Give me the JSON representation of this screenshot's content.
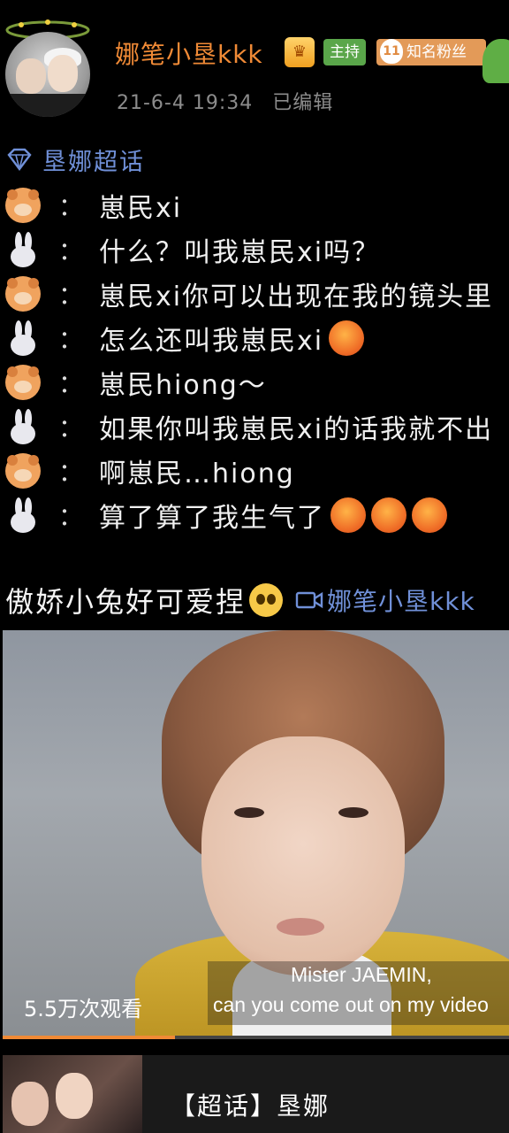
{
  "header": {
    "username": "娜笔小垦kkk",
    "timestamp": "21-6-4 19:34",
    "edited": "已编辑",
    "host_badge": "主持",
    "fan_level": "11",
    "fan_badge": "知名粉丝",
    "colors": {
      "username": "#f08a36",
      "host_badge": "#5aa64a",
      "fan_badge": "#e39a58"
    }
  },
  "topic": {
    "label": "垦娜超话",
    "color": "#7090d8",
    "icon": "diamond-icon"
  },
  "dialog": [
    {
      "speaker": "hamster",
      "text": "崽民xi",
      "angry_count": 0
    },
    {
      "speaker": "rabbit",
      "text": "什么？叫我崽民xi吗？",
      "angry_count": 0
    },
    {
      "speaker": "hamster",
      "text": "崽民xi你可以出现在我的镜头里",
      "angry_count": 0
    },
    {
      "speaker": "rabbit",
      "text": "怎么还叫我崽民xi",
      "angry_count": 1
    },
    {
      "speaker": "hamster",
      "text": "崽民hiong～",
      "angry_count": 0
    },
    {
      "speaker": "rabbit",
      "text": "如果你叫我崽民xi的话我就不出",
      "angry_count": 0
    },
    {
      "speaker": "hamster",
      "text": "啊崽民…hiong",
      "angry_count": 0
    },
    {
      "speaker": "rabbit",
      "text": "算了算了我生气了",
      "angry_count": 3
    }
  ],
  "colon": "：",
  "caption": {
    "text": "傲娇小兔好可爱捏",
    "video_link": "娜笔小垦kkk",
    "video_icon": "video-camera-icon"
  },
  "video": {
    "subtitle_line1": "Mister JAEMIN,",
    "subtitle_line2": "can you come out on my video",
    "views": "5.5万次观看",
    "progress": 0.34
  },
  "card": {
    "title": "【超话】垦娜"
  }
}
